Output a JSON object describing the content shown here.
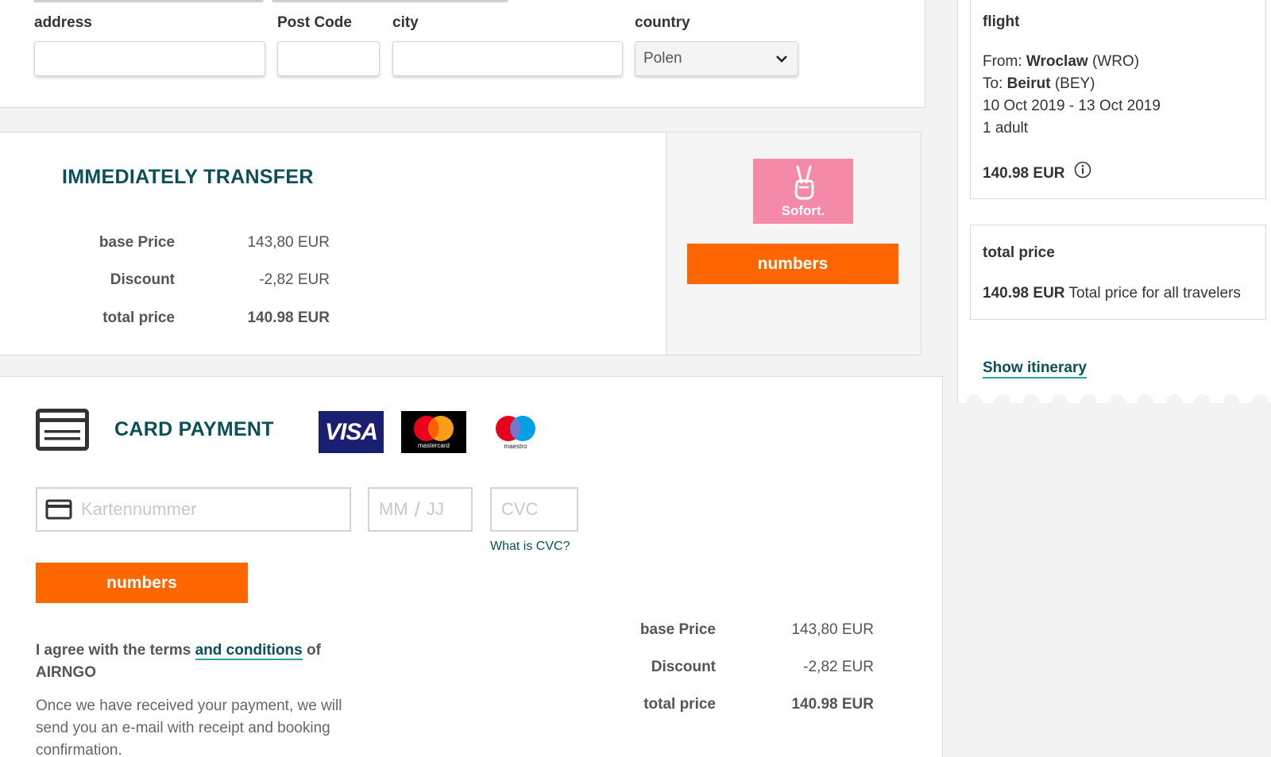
{
  "address_form": {
    "address_label": "address",
    "postcode_label": "Post Code",
    "city_label": "city",
    "country_label": "country",
    "country_value": "Polen"
  },
  "transfer": {
    "title": "IMMEDIATELY TRANSFER",
    "base_price_label": "base Price",
    "base_price_value": "143,80",
    "discount_label": "Discount",
    "discount_value": "-2,82",
    "currency": "EUR",
    "total_label": "total price",
    "total_value": "140.98 EUR",
    "logo_text": "Sofort.",
    "button_label": "numbers"
  },
  "card": {
    "title": "CARD PAYMENT",
    "brands": {
      "visa": "VISA",
      "mastercard": "mastercard",
      "maestro": "maestro"
    },
    "card_number_placeholder": "Kartennummer",
    "expiry_mm": "MM",
    "expiry_sep": "/",
    "expiry_jj": "JJ",
    "cvc_placeholder": "CVC",
    "cvc_help": "What is CVC?",
    "button_label": "numbers",
    "terms_prefix": "I agree with the terms",
    "terms_link": "and conditions",
    "terms_suffix": "of",
    "terms_company": "AIRNGO",
    "info_text": "Once we have received your payment, we will send you an e-mail with receipt and booking confirmation.",
    "base_price_label": "base Price",
    "base_price_value": "143,80",
    "discount_label": "Discount",
    "discount_value": "-2,82",
    "currency": "EUR",
    "total_label": "total price",
    "total_value": "140.98 EUR"
  },
  "sidebar": {
    "flight_title": "flight",
    "from_label": "From:",
    "from_city": "Wroclaw",
    "from_code": "(WRO)",
    "to_label": "To:",
    "to_city": "Beirut",
    "to_code": "(BEY)",
    "dates": "10 Oct 2019 - 13 Oct 2019",
    "passengers": "1 adult",
    "price": "140.98 EUR",
    "total_title": "total price",
    "total_price": "140.98 EUR",
    "total_note": "Total price for all travelers",
    "itinerary_link": "Show itinerary"
  },
  "colors": {
    "accent_teal": "#0c4f57",
    "button_orange": "#ff6600",
    "sofort_pink": "#f58aa8",
    "visa_blue": "#1a1f71"
  }
}
